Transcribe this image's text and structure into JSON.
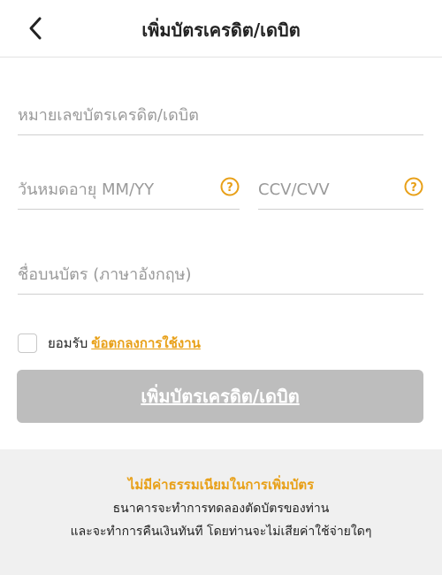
{
  "header": {
    "title": "เพิ่มบัตรเครดิต/เดบิต",
    "back_icon": "chevron-left-icon"
  },
  "form": {
    "card_number_placeholder": "หมายเลขบัตรเครดิต/เดบิต",
    "card_number_value": "",
    "expiry_placeholder": "วันหมดอายุ MM/YY",
    "expiry_value": "",
    "cvv_placeholder": "CCV/CVV",
    "cvv_value": "",
    "name_placeholder": "ชื่อบนบัตร (ภาษาอังกฤษ)",
    "name_value": "",
    "help_icon": "question-circle-icon"
  },
  "terms": {
    "checked": false,
    "prefix": "ยอมรับ",
    "link_label": "ข้อตกลงการใช้งาน"
  },
  "submit": {
    "label": "เพิ่มบัตรเครดิต/เดบิต",
    "enabled": false
  },
  "footer": {
    "highlight": "ไม่มีค่าธรรมเนียมในการเพิ่มบัตร",
    "line1": "ธนาคารจะทำการทดลองตัดบัตรของท่าน",
    "line2": "และจะทำการคืนเงินทันที โดยท่านจะไม่เสียค่าใช้จ่ายใดๆ"
  },
  "colors": {
    "accent": "#e8a018",
    "button_disabled": "#bdbdbd",
    "footer_bg": "#f0f0f0",
    "underline": "#cfcfcf"
  }
}
